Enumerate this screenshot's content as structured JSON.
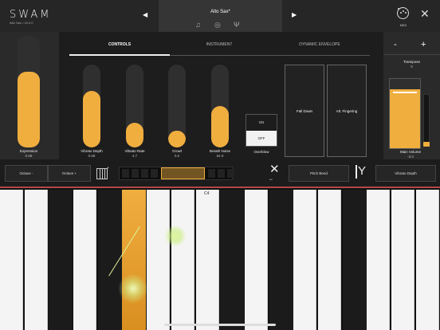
{
  "app": {
    "logo": "SWAM",
    "version": "Alto Sax • v3.0.0"
  },
  "preset": {
    "name": "Alto Sax*",
    "prev": "◀",
    "next": "▶"
  },
  "header": {
    "midi_label": "MIDI"
  },
  "tabs": [
    {
      "label": "CONTROLS",
      "active": true
    },
    {
      "label": "INSTRUMENT",
      "active": false
    },
    {
      "label": "DYNAMIC ENVELOPE",
      "active": false
    }
  ],
  "sliders": [
    {
      "label": "Expression",
      "value": "0.68",
      "level": 0.68
    },
    {
      "label": "Vibrato Depth",
      "value": "0.68",
      "level": 0.68
    },
    {
      "label": "Vibrato Rate",
      "value": "4.7",
      "level": 0.3
    },
    {
      "label": "Growl",
      "value": "0.0",
      "level": 0.2
    },
    {
      "label": "Breath Noise",
      "value": "64.0",
      "level": 0.5
    }
  ],
  "overblow": {
    "label": "Overblow",
    "on": "ON",
    "off": "OFF",
    "state": "OFF"
  },
  "articulations": [
    "Fall Down",
    "Alt. Fingering"
  ],
  "right": {
    "minus": "-",
    "plus": "+",
    "transpose_label": "Transpose",
    "transpose_value": "0",
    "main_volume_label": "Main Volume",
    "main_volume_value": "-3.0",
    "main_volume_level": 0.85
  },
  "toolbar": {
    "octave_minus": "Octave -",
    "octave_plus": "Octave +",
    "pitch_bend": "Pitch Bend",
    "vibrato_depth": "Vibrato Depth"
  },
  "keyboard": {
    "note_label": "C4"
  },
  "colors": {
    "accent": "#f0ae3f",
    "touch": "#dff59a",
    "line": "#b24848"
  }
}
